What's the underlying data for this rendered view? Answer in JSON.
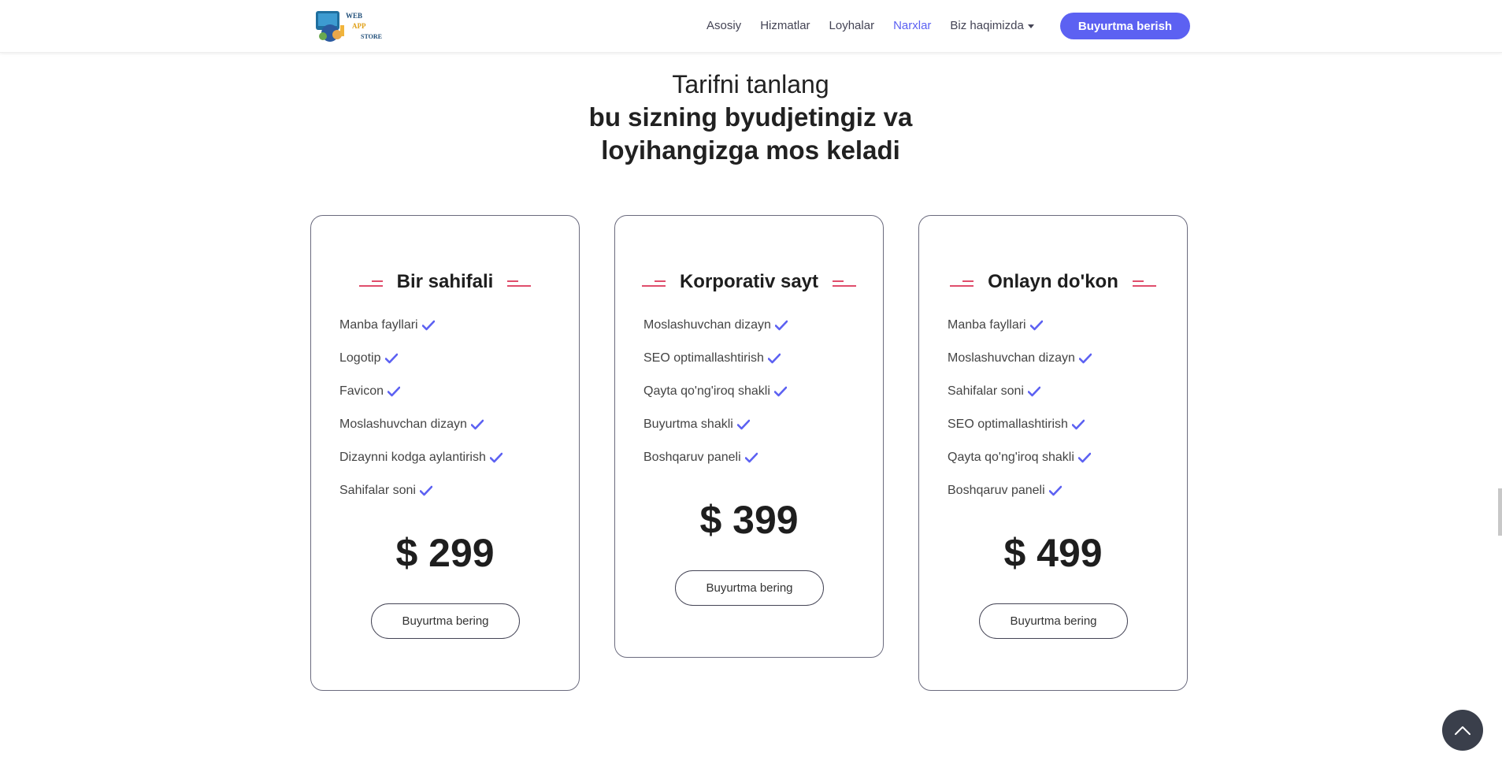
{
  "brand": {
    "logo_lines": [
      "WEB",
      "APP",
      "STORE"
    ],
    "accent_color": "#5c61f2",
    "deco_color": "#e04e6c"
  },
  "nav": {
    "items": [
      {
        "label": "Asosiy",
        "active": false
      },
      {
        "label": "Hizmatlar",
        "active": false
      },
      {
        "label": "Loyhalar",
        "active": false
      },
      {
        "label": "Narxlar",
        "active": true
      },
      {
        "label": "Biz haqimizda",
        "active": false,
        "dropdown": true
      }
    ],
    "cta_label": "Buyurtma berish"
  },
  "pricing": {
    "subtitle": "Tarifni tanlang",
    "title": "bu sizning byudjetingiz va loyihangizga mos keladi",
    "plans": [
      {
        "name": "Bir sahifali",
        "features": [
          "Manba fayllari",
          "Logotip",
          "Favicon",
          "Moslashuvchan dizayn",
          "Dizaynni kodga aylantirish",
          "Sahifalar soni"
        ],
        "price": "$ 299",
        "button_label": "Buyurtma bering"
      },
      {
        "name": "Korporativ sayt",
        "features": [
          "Moslashuvchan dizayn",
          "SEO optimallashtirish",
          "Qayta qo'ng'iroq shakli",
          "Buyurtma shakli",
          "Boshqaruv paneli"
        ],
        "price": "$ 399",
        "button_label": "Buyurtma bering"
      },
      {
        "name": "Onlayn do'kon",
        "features": [
          "Manba fayllari",
          "Moslashuvchan dizayn",
          "Sahifalar soni",
          "SEO optimallashtirish",
          "Qayta qo'ng'iroq shakli",
          "Boshqaruv paneli"
        ],
        "price": "$ 499",
        "button_label": "Buyurtma bering"
      }
    ]
  },
  "icons": {
    "feature_check": "check-icon",
    "back_to_top": "chevron-up-icon",
    "nav_dropdown": "caret-down-icon"
  }
}
